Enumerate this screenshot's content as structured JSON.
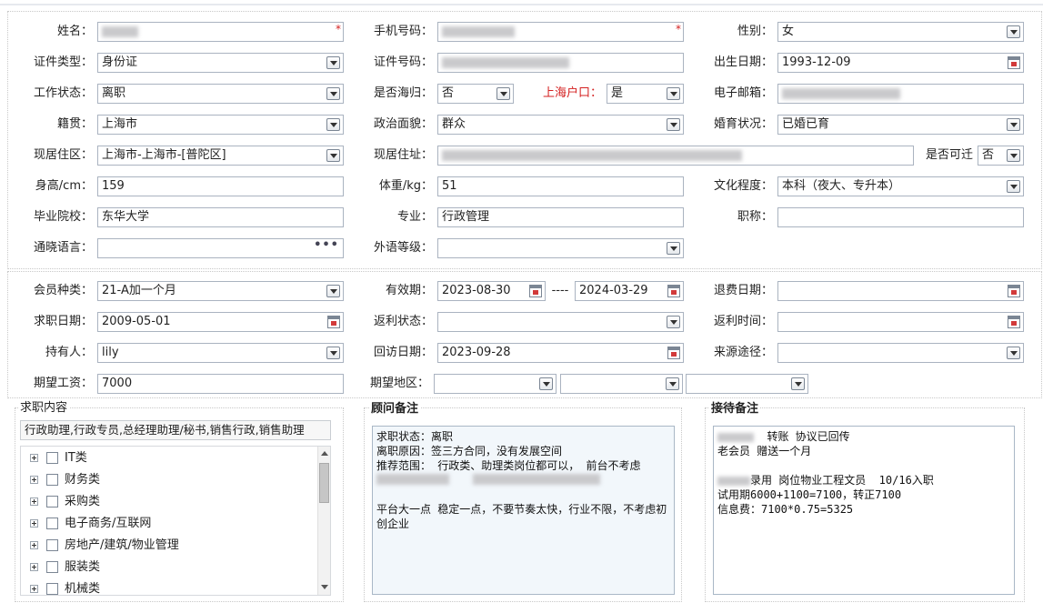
{
  "personal": {
    "name": {
      "label": "姓名：",
      "value": "",
      "required": "*"
    },
    "phone": {
      "label": "手机号码：",
      "value": "",
      "required": "*"
    },
    "gender": {
      "label": "性别：",
      "value": "女"
    },
    "id_type": {
      "label": "证件类型：",
      "value": "身份证"
    },
    "id_number": {
      "label": "证件号码：",
      "value": ""
    },
    "birth_date": {
      "label": "出生日期：",
      "value": "1993-12-09"
    },
    "work_status": {
      "label": "工作状态：",
      "value": "离职"
    },
    "returnee": {
      "label": "是否海归：",
      "value": "否"
    },
    "shanghai_hukou": {
      "label": "上海户口：",
      "value": "是"
    },
    "email": {
      "label": "电子邮箱：",
      "value": ""
    },
    "native_place": {
      "label": "籍贯：",
      "value": "上海市"
    },
    "political": {
      "label": "政治面貌：",
      "value": "群众"
    },
    "marital": {
      "label": "婚育状况：",
      "value": "已婚已育"
    },
    "residence_area": {
      "label": "现居住区：",
      "value": "上海市-上海市-[普陀区]"
    },
    "residence_address": {
      "label": "现居住址：",
      "value": ""
    },
    "relocatable": {
      "label": "是否可迁",
      "value": "否"
    },
    "height": {
      "label": "身高/cm：",
      "value": "159"
    },
    "weight": {
      "label": "体重/kg：",
      "value": "51"
    },
    "education": {
      "label": "文化程度：",
      "value": "本科（夜大、专升本）"
    },
    "school": {
      "label": "毕业院校：",
      "value": "东华大学"
    },
    "major": {
      "label": "专业：",
      "value": "行政管理"
    },
    "title": {
      "label": "职称：",
      "value": ""
    },
    "languages": {
      "label": "通晓语言：",
      "value": "",
      "more": "•••"
    },
    "foreign_level": {
      "label": "外语等级：",
      "value": ""
    }
  },
  "membership": {
    "member_type": {
      "label": "会员种类：",
      "value": "21-A加一个月"
    },
    "validity": {
      "label": "有效期：",
      "start": "2023-08-30",
      "separator": "----",
      "end": "2024-03-29"
    },
    "refund_date": {
      "label": "退费日期：",
      "value": ""
    },
    "job_seek_date": {
      "label": "求职日期：",
      "value": "2009-05-01"
    },
    "rebate_status": {
      "label": "返利状态：",
      "value": ""
    },
    "rebate_time": {
      "label": "返利时间：",
      "value": ""
    },
    "holder": {
      "label": "持有人：",
      "value": "lily"
    },
    "follow_up_date": {
      "label": "回访日期：",
      "value": "2023-09-28"
    },
    "source": {
      "label": "来源途径：",
      "value": ""
    },
    "expected_salary": {
      "label": "期望工资：",
      "value": "7000"
    },
    "expected_area": {
      "label": "期望地区：",
      "value1": "",
      "value2": "",
      "value3": ""
    }
  },
  "job_content": {
    "title": "求职内容",
    "selected": "行政助理,行政专员,总经理助理/秘书,销售行政,销售助理",
    "categories": [
      "IT类",
      "财务类",
      "采购类",
      "电子商务/互联网",
      "房地产/建筑/物业管理",
      "服装类",
      "机械类"
    ]
  },
  "advisor_notes": {
    "title": "顾问备注",
    "text": "求职状态：离职\n离职原因：签三方合同，没有发展空间\n推荐范围： 行政类、助理类岗位都可以， 前台不考虑\n\n\n平台大一点 稳定一点，不要节奏太快，行业不限，不考虑初创企业"
  },
  "reception_notes": {
    "title": "接待备注",
    "line1": "  转账 协议已回传",
    "line2": "老会员 赠送一个月",
    "line3": "录用 岗位物业工程文员  10/16入职",
    "line4": "试用期6000+1100=7100，转正7100",
    "line5": "信息费：7100*0.75=5325"
  }
}
